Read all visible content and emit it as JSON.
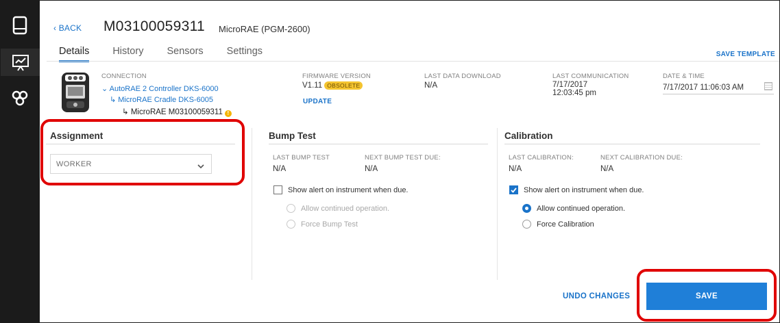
{
  "header": {
    "back_label": "‹ BACK",
    "device_id": "M03100059311",
    "device_model": "MicroRAE (PGM-2600)",
    "save_template_label": "SAVE TEMPLATE"
  },
  "tabs": [
    {
      "label": "Details",
      "active": true
    },
    {
      "label": "History",
      "active": false
    },
    {
      "label": "Sensors",
      "active": false
    },
    {
      "label": "Settings",
      "active": false
    }
  ],
  "info": {
    "connection_label": "CONNECTION",
    "connection_chain": [
      "⌄ AutoRAE 2 Controller DKS-6000",
      "↳ MicroRAE Cradle DKS-6005",
      "↳ MicroRAE M03100059311"
    ],
    "firmware_label": "FIRMWARE VERSION",
    "firmware_value": "V1.11",
    "firmware_badge": "OBSOLETE",
    "update_label": "UPDATE",
    "last_download_label": "LAST DATA DOWNLOAD",
    "last_download_value": "N/A",
    "last_comm_label": "LAST COMMUNICATION",
    "last_comm_date": "7/17/2017",
    "last_comm_time": "12:03:45 pm",
    "datetime_label": "DATE & TIME",
    "datetime_value": "7/17/2017 11:06:03 AM"
  },
  "assignment": {
    "title": "Assignment",
    "selected": "WORKER"
  },
  "bump": {
    "title": "Bump Test",
    "last_label": "LAST BUMP TEST",
    "last_value": "N/A",
    "next_label": "NEXT BUMP TEST DUE:",
    "next_value": "N/A",
    "alert_label": "Show alert on instrument when due.",
    "alert_checked": false,
    "opt1": "Allow continued operation.",
    "opt2": "Force Bump Test"
  },
  "calibration": {
    "title": "Calibration",
    "last_label": "LAST CALIBRATION:",
    "last_value": "N/A",
    "next_label": "NEXT CALIBRATION DUE:",
    "next_value": "N/A",
    "alert_label": "Show alert on instrument when due.",
    "alert_checked": true,
    "opt1": "Allow continued operation.",
    "opt2": "Force Calibration"
  },
  "actions": {
    "undo_label": "UNDO CHANGES",
    "save_label": "SAVE"
  },
  "colors": {
    "accent": "#1a73c9",
    "rail": "#1b1b1b",
    "highlight": "#e00000",
    "badge": "#f4c430"
  }
}
